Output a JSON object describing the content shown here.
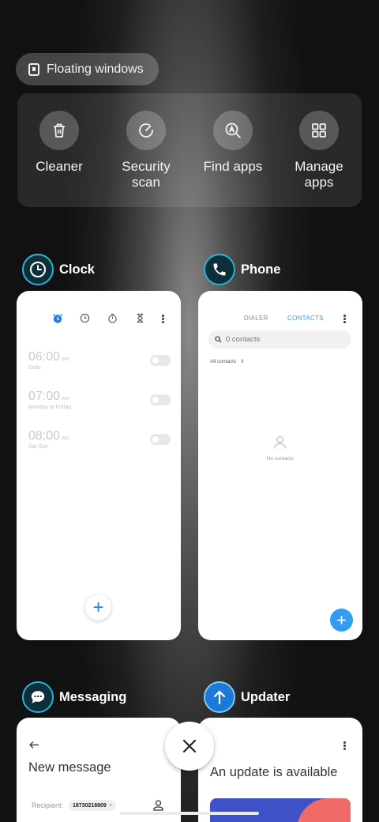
{
  "floating_windows": {
    "label": "Floating windows"
  },
  "quick_actions": [
    {
      "label": "Cleaner",
      "icon": "trash-icon"
    },
    {
      "label": "Security\nscan",
      "icon": "security-scan-icon"
    },
    {
      "label": "Find apps",
      "icon": "find-apps-icon"
    },
    {
      "label": "Manage\napps",
      "icon": "grid-icon"
    }
  ],
  "apps": {
    "clock": {
      "name": "Clock",
      "alarms": [
        {
          "time": "06:00",
          "ampm": "am",
          "repeat": "Daily",
          "enabled": false
        },
        {
          "time": "07:00",
          "ampm": "am",
          "repeat": "Monday to Friday",
          "enabled": false
        },
        {
          "time": "08:00",
          "ampm": "am",
          "repeat": "Sat Sun",
          "enabled": false
        }
      ],
      "fab": "+"
    },
    "phone": {
      "name": "Phone",
      "tabs": [
        "DIALER",
        "CONTACTS"
      ],
      "active_tab": "CONTACTS",
      "search_placeholder": "0 contacts",
      "filter": "All contacts",
      "empty_text": "No contacts",
      "fab": "+"
    },
    "messaging": {
      "name": "Messaging",
      "title": "New message",
      "recipient_label": "Recipient:",
      "recipient_chip": "18730218809"
    },
    "updater": {
      "name": "Updater",
      "title": "An update is available"
    }
  },
  "colors": {
    "accent_blue": "#1f7ff0",
    "contacts_tab": "#2f9df0",
    "icon_ring": "#27b5d8"
  }
}
